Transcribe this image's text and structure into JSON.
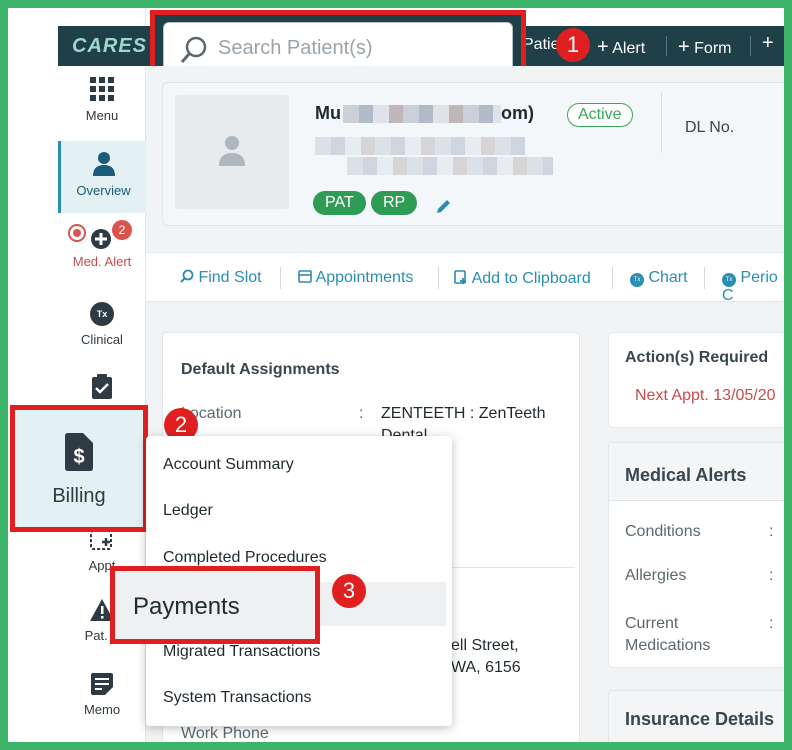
{
  "app": {
    "logo": "CARES"
  },
  "search": {
    "placeholder": "Search Patient(s)"
  },
  "topbar": {
    "patient_partial": "Patie",
    "alert": "Alert",
    "form": "Form",
    "plus": "+"
  },
  "steps": [
    "1",
    "2",
    "3"
  ],
  "sidebar": {
    "items": [
      {
        "label": "Menu"
      },
      {
        "label": "Overview"
      },
      {
        "label": "Med. Alert",
        "badge": "2"
      },
      {
        "label": "Clinical",
        "icon_text": "Tx"
      },
      {
        "label": ""
      },
      {
        "label": "Billing"
      },
      {
        "label": "Appt"
      },
      {
        "label": "Pat. A"
      },
      {
        "label": "Memo"
      }
    ]
  },
  "patient": {
    "name_start": "Mu",
    "name_end": "om)",
    "status": "Active",
    "dl_label": "DL No.",
    "tags": [
      "PAT",
      "RP"
    ]
  },
  "actions": [
    {
      "label": "Find Slot"
    },
    {
      "label": "Appointments"
    },
    {
      "label": "Add to Clipboard"
    },
    {
      "label": "Chart",
      "icon_text": "Tx"
    },
    {
      "label": "Perio C",
      "icon_text": "Tx"
    }
  ],
  "default_assignments": {
    "title": "Default Assignments",
    "location_label": "Location",
    "colon": ":",
    "location_value_1": "ZENTEETH : ZenTeeth",
    "location_value_2": "Dental",
    "address_1": "ell Street,",
    "address_2": "WA, 6156",
    "work_phone_label": "Work Phone"
  },
  "actions_required": {
    "title": "Action(s) Required",
    "next_appt": "Next Appt. 13/05/20"
  },
  "medical_alerts": {
    "title": "Medical Alerts",
    "conditions": "Conditions",
    "allergies": "Allergies",
    "current_1": "Current",
    "current_2": "Medications",
    "colon": ":"
  },
  "insurance": {
    "title": "Insurance Details"
  },
  "billing_menu": {
    "items": [
      "Account Summary",
      "Ledger",
      "Completed Procedures",
      "Payments",
      "Migrated Transactions",
      "System Transactions"
    ]
  },
  "colors": {
    "accent": "#2a8db3",
    "highlight": "#e02020",
    "topbar": "#1f3f49",
    "border": "#3cb56b"
  }
}
